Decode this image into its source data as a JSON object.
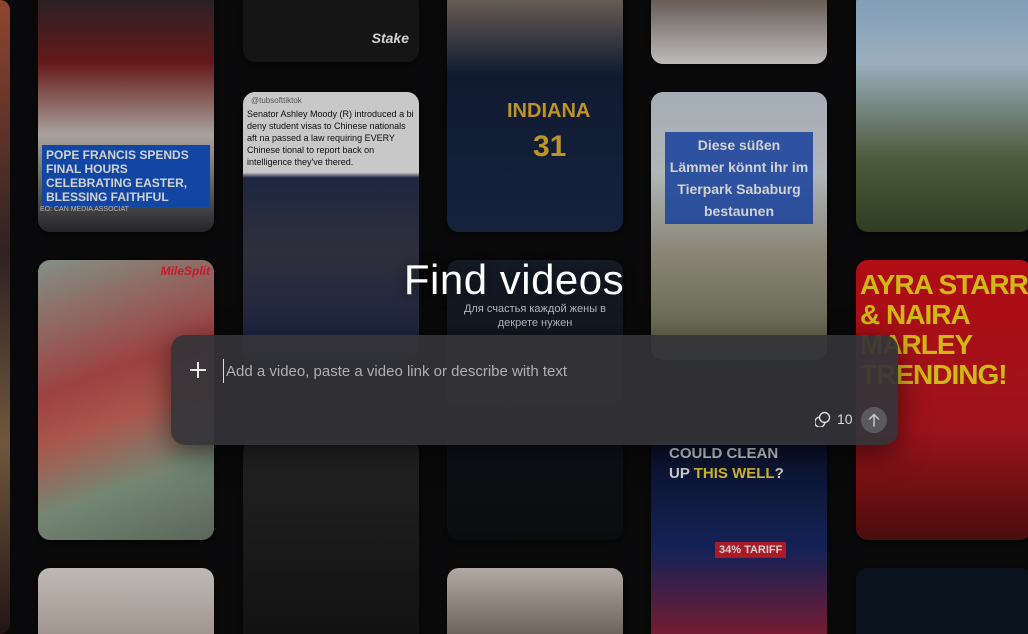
{
  "page": {
    "title": "Find videos"
  },
  "search": {
    "placeholder": "Add a video, paste a video link or describe with text",
    "credit_count": "10",
    "add_icon": "plus-icon",
    "credit_icon": "coins-icon",
    "submit_icon": "arrow-up-icon"
  },
  "tiles": {
    "pope": {
      "caption": "POPE FRANCIS SPENDS FINAL HOURS CELEBRATING EASTER, BLESSING FAITHFUL",
      "source": "EO: CAN MEDIA ASSOCIAT"
    },
    "track": {
      "logo": "MileSplit"
    },
    "suit": {
      "logo": "Stake"
    },
    "news": {
      "handle": "@tubsofttiktok",
      "text": "Senator Ashley Moody (R) introduced a bi deny student visas to Chinese nationals aft na passed a law requiring EVERY Chinese tional to report back on intelligence they've thered."
    },
    "indiana": {
      "jersey_text": "INDIANA",
      "jersey_number": "31"
    },
    "russian": {
      "text": "Для счастья каждой жены в декрете нужен"
    },
    "sheep": {
      "text": "Diese süßen Lämmer könnt ihr im Tierpark Sababurg bestaunen"
    },
    "xi": {
      "line1": "COULD CLEAN",
      "line2_a": "UP ",
      "line2_b": "THIS WELL",
      "line2_c": "?",
      "tariff": "34% TARIFF"
    },
    "ayra": {
      "text": "AYRA STARR & NAIRA MARLEY TRENDING!"
    }
  },
  "colors": {
    "background": "#0c0c0e",
    "searchbox": "#343438",
    "text": "#ffffff"
  }
}
